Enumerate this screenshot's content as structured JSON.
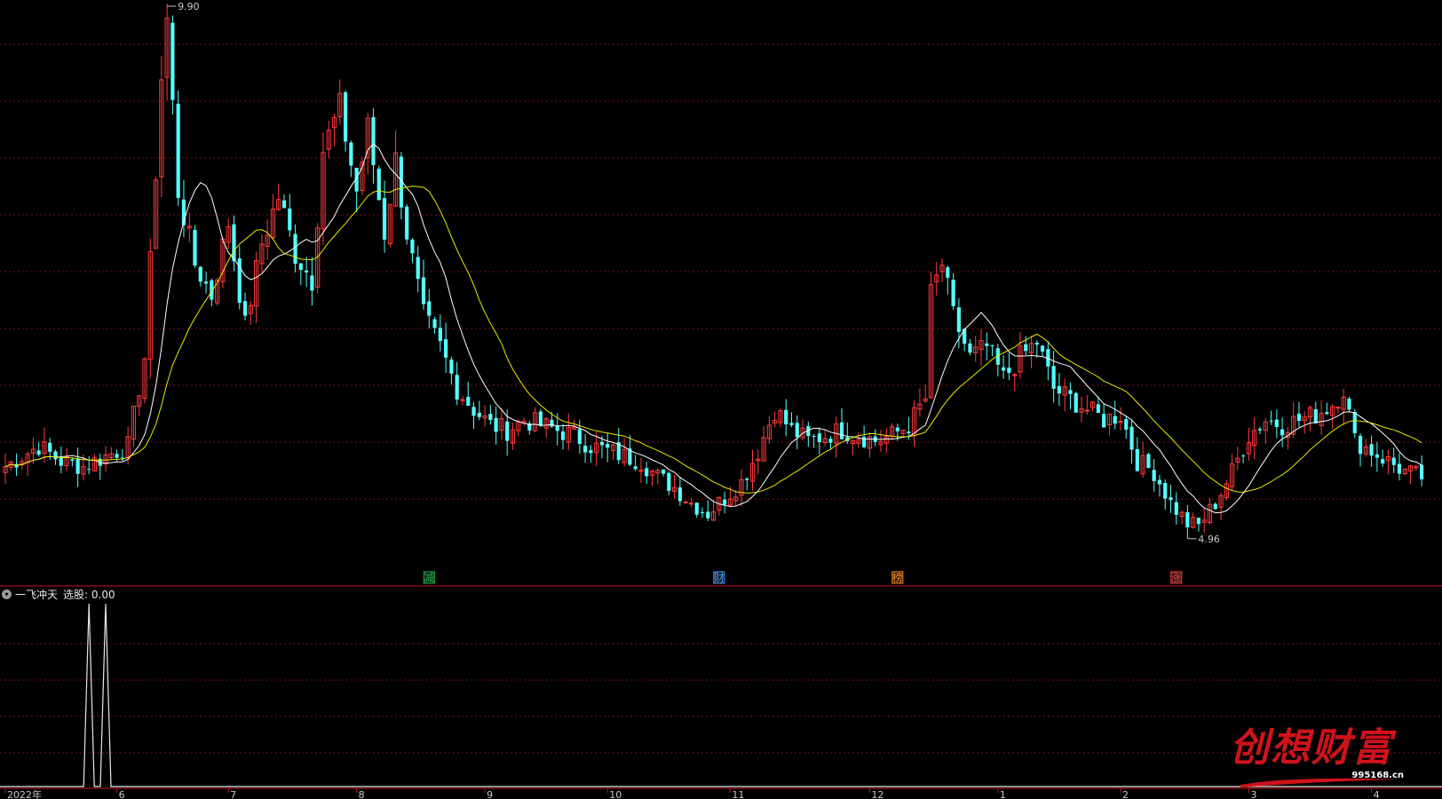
{
  "chart_data": {
    "type": "candlestick",
    "price_range": [
      4.7,
      10.0
    ],
    "annotations": {
      "high_label": "9.90",
      "low_label": "4.96"
    },
    "x_axis_labels": [
      "2022年",
      "6",
      "7",
      "8",
      "9",
      "10",
      "11",
      "12",
      "1",
      "2",
      "3",
      "4"
    ],
    "ma_lines": [
      {
        "color": "#ffffff"
      },
      {
        "color": "#e8e800"
      }
    ],
    "markers": [
      {
        "text": "减",
        "color": "#1fb64a"
      },
      {
        "text": "财",
        "color": "#4a9cff"
      },
      {
        "text": "榜",
        "color": "#ff8a1f"
      },
      {
        "text": "涨",
        "color": "#ff3b3b"
      }
    ],
    "anchors": [
      [
        0,
        5.55
      ],
      [
        6,
        5.75
      ],
      [
        10,
        5.6
      ],
      [
        14,
        5.55
      ],
      [
        18,
        5.65
      ],
      [
        22,
        5.75
      ],
      [
        25,
        6.6
      ],
      [
        28,
        9.3
      ],
      [
        29,
        9.85
      ],
      [
        31,
        8.2
      ],
      [
        34,
        7.5
      ],
      [
        37,
        7.2
      ],
      [
        40,
        7.9
      ],
      [
        43,
        6.9
      ],
      [
        46,
        7.7
      ],
      [
        49,
        8.15
      ],
      [
        52,
        7.6
      ],
      [
        55,
        7.35
      ],
      [
        57,
        8.6
      ],
      [
        60,
        9.0
      ],
      [
        63,
        8.2
      ],
      [
        65,
        8.8
      ],
      [
        68,
        7.8
      ],
      [
        70,
        8.5
      ],
      [
        72,
        7.8
      ],
      [
        75,
        7.0
      ],
      [
        78,
        6.7
      ],
      [
        81,
        6.3
      ],
      [
        84,
        6.1
      ],
      [
        87,
        5.95
      ],
      [
        90,
        5.9
      ],
      [
        93,
        6.0
      ],
      [
        96,
        5.95
      ],
      [
        99,
        5.9
      ],
      [
        102,
        5.85
      ],
      [
        105,
        5.75
      ],
      [
        108,
        5.7
      ],
      [
        111,
        5.65
      ],
      [
        114,
        5.6
      ],
      [
        117,
        5.45
      ],
      [
        120,
        5.35
      ],
      [
        123,
        5.2
      ],
      [
        126,
        5.1
      ],
      [
        129,
        5.25
      ],
      [
        132,
        5.4
      ],
      [
        135,
        5.7
      ],
      [
        138,
        6.1
      ],
      [
        141,
        5.9
      ],
      [
        144,
        5.8
      ],
      [
        147,
        5.85
      ],
      [
        150,
        5.9
      ],
      [
        153,
        5.85
      ],
      [
        156,
        5.8
      ],
      [
        159,
        5.85
      ],
      [
        162,
        5.95
      ],
      [
        165,
        6.2
      ],
      [
        166,
        7.2
      ],
      [
        168,
        7.5
      ],
      [
        170,
        7.0
      ],
      [
        173,
        6.6
      ],
      [
        176,
        6.7
      ],
      [
        179,
        6.4
      ],
      [
        182,
        6.6
      ],
      [
        185,
        6.75
      ],
      [
        188,
        6.3
      ],
      [
        191,
        6.2
      ],
      [
        194,
        6.1
      ],
      [
        197,
        6.0
      ],
      [
        200,
        6.05
      ],
      [
        203,
        5.6
      ],
      [
        206,
        5.5
      ],
      [
        209,
        5.2
      ],
      [
        212,
        5.0
      ],
      [
        214,
        4.98
      ],
      [
        217,
        5.2
      ],
      [
        220,
        5.5
      ],
      [
        223,
        5.85
      ],
      [
        226,
        6.0
      ],
      [
        229,
        5.95
      ],
      [
        232,
        6.0
      ],
      [
        235,
        6.05
      ],
      [
        238,
        6.15
      ],
      [
        240,
        6.3
      ],
      [
        242,
        5.8
      ],
      [
        245,
        5.7
      ],
      [
        248,
        5.6
      ],
      [
        251,
        5.5
      ],
      [
        254,
        5.45
      ]
    ]
  },
  "indicator": {
    "toggle_icon": "chevron-down-icon",
    "name": "一飞冲天",
    "value_label": "选股: 0.00",
    "spikes_at_index": [
      15,
      18
    ]
  },
  "watermark": {
    "brand": "创想财富",
    "site": "995168.cn"
  }
}
